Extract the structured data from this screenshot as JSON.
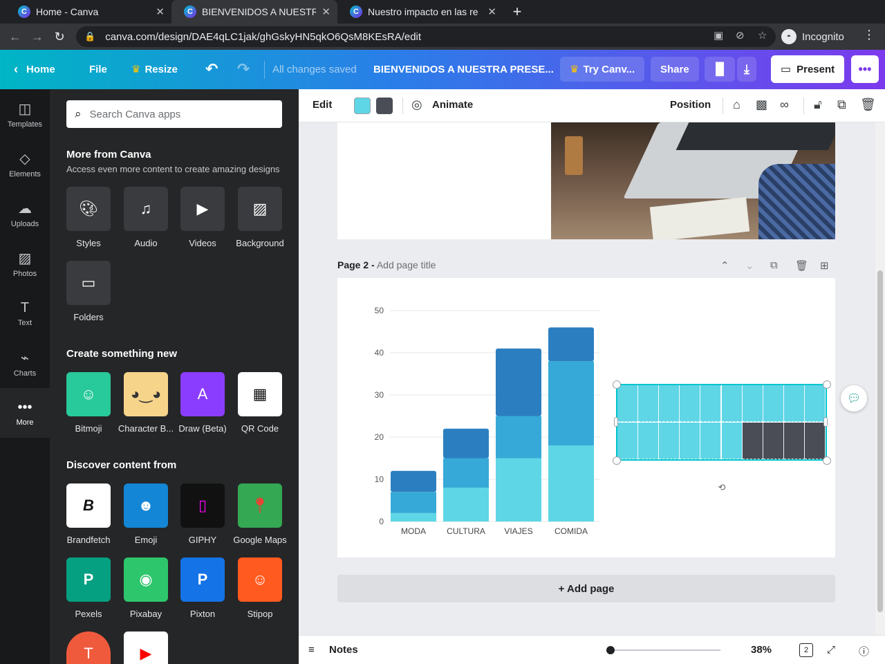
{
  "browser": {
    "tabs": [
      {
        "title": "Home - Canva",
        "active": false
      },
      {
        "title": "BIENVENIDOS A NUESTRA",
        "active": true
      },
      {
        "title": "Nuestro impacto en las re",
        "active": false
      }
    ],
    "url": "canva.com/design/DAE4qLC1jak/ghGskyHN5qkO6QsM8KEsRA/edit",
    "profile_label": "Incognito"
  },
  "header": {
    "home": "Home",
    "file": "File",
    "resize": "Resize",
    "saved": "All changes saved",
    "doc_title": "BIENVENIDOS A NUESTRA PRESE...",
    "try": "Try Canv...",
    "share": "Share",
    "present": "Present"
  },
  "rail": [
    {
      "label": "Templates",
      "icon": "templates-icon"
    },
    {
      "label": "Elements",
      "icon": "elements-icon"
    },
    {
      "label": "Uploads",
      "icon": "uploads-icon"
    },
    {
      "label": "Photos",
      "icon": "photos-icon"
    },
    {
      "label": "Text",
      "icon": "text-icon"
    },
    {
      "label": "Charts",
      "icon": "charts-icon"
    },
    {
      "label": "More",
      "icon": "more-icon"
    }
  ],
  "panel": {
    "search_placeholder": "Search Canva apps",
    "more_title": "More from Canva",
    "more_sub": "Access even more content to create amazing designs",
    "more_items": [
      "Styles",
      "Audio",
      "Videos",
      "Background",
      "Folders"
    ],
    "create_title": "Create something new",
    "create_items": [
      "Bitmoji",
      "Character B...",
      "Draw (Beta)",
      "QR Code"
    ],
    "discover_title": "Discover content from",
    "discover_items": [
      "Brandfetch",
      "Emoji",
      "GIPHY",
      "Google Maps",
      "Pexels",
      "Pixabay",
      "Pixton",
      "Stipop"
    ]
  },
  "toolbar": {
    "edit": "Edit",
    "animate": "Animate",
    "position": "Position",
    "swatches": [
      "#5ed6e6",
      "#4a4d55"
    ]
  },
  "page2": {
    "label": "Page 2 -",
    "title_placeholder": "Add page title"
  },
  "add_page": "+ Add page",
  "footer": {
    "notes": "Notes",
    "zoom": "38%",
    "page_count": "2"
  },
  "chart_data": {
    "type": "bar",
    "stacked": true,
    "categories": [
      "MODA",
      "CULTURA",
      "VIAJES",
      "COMIDA"
    ],
    "series": [
      {
        "values": [
          2,
          8,
          15,
          18
        ],
        "color": "#5ed6e6"
      },
      {
        "values": [
          5,
          7,
          10,
          20
        ],
        "color": "#36a9d8"
      },
      {
        "values": [
          5,
          7,
          16,
          8
        ],
        "color": "#2b7fc0"
      }
    ],
    "ylim": [
      0,
      50
    ],
    "yticks": [
      0,
      10,
      20,
      30,
      40,
      50
    ],
    "grid": true
  },
  "grid_element": {
    "filled_cells": 16,
    "total_cells": 20,
    "fill_color": "#5ed6e6",
    "empty_color": "#4a4d55"
  }
}
